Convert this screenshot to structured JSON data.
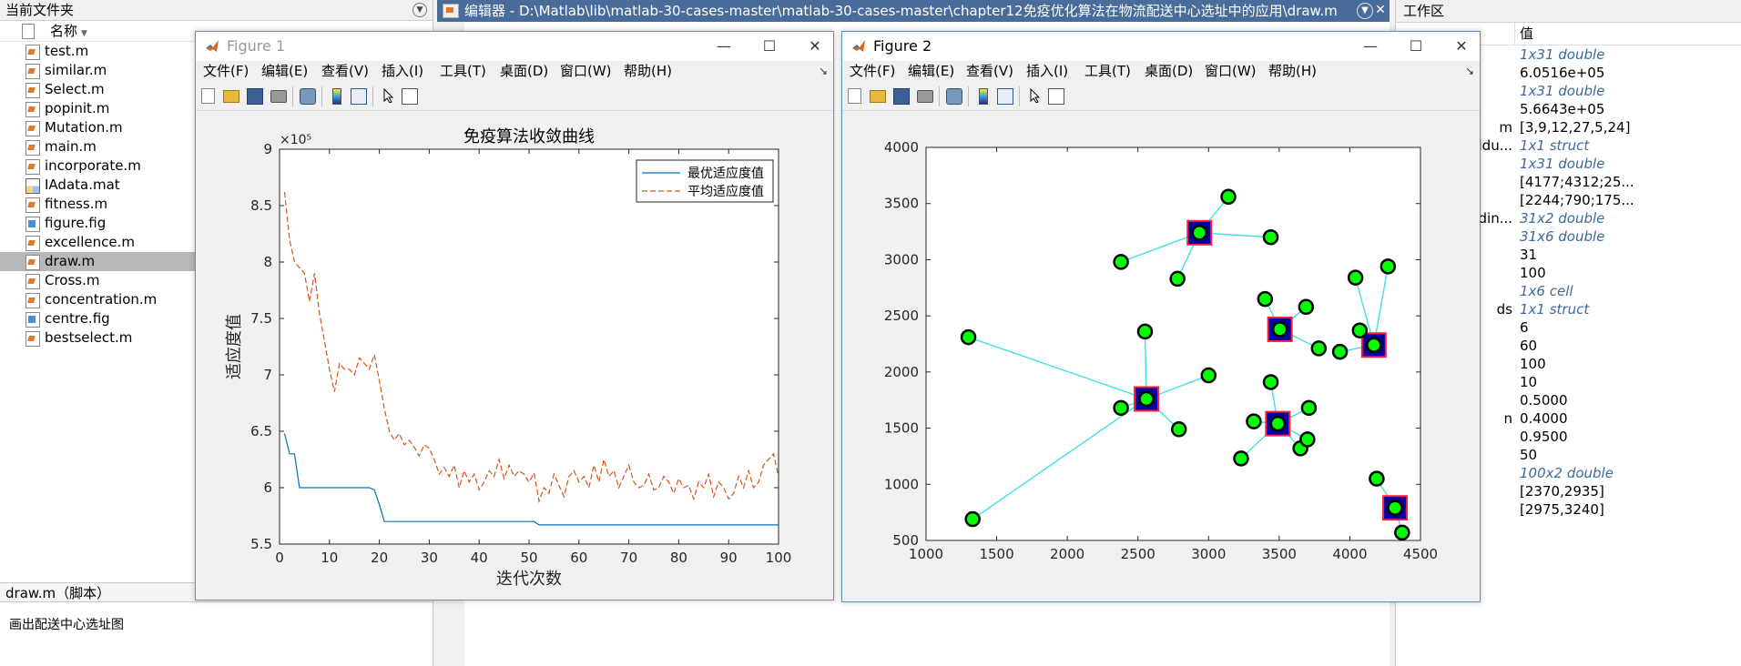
{
  "left_panel": {
    "header": "当前文件夹",
    "column_name": "名称",
    "files": [
      {
        "name": "test.m",
        "type": "m"
      },
      {
        "name": "similar.m",
        "type": "m"
      },
      {
        "name": "Select.m",
        "type": "m"
      },
      {
        "name": "popinit.m",
        "type": "m"
      },
      {
        "name": "Mutation.m",
        "type": "m"
      },
      {
        "name": "main.m",
        "type": "m"
      },
      {
        "name": "incorporate.m",
        "type": "m"
      },
      {
        "name": "IAdata.mat",
        "type": "mat"
      },
      {
        "name": "fitness.m",
        "type": "m"
      },
      {
        "name": "figure.fig",
        "type": "fig"
      },
      {
        "name": "excellence.m",
        "type": "m"
      },
      {
        "name": "draw.m",
        "type": "m",
        "selected": true
      },
      {
        "name": "Cross.m",
        "type": "m"
      },
      {
        "name": "concentration.m",
        "type": "m"
      },
      {
        "name": "centre.fig",
        "type": "fig"
      },
      {
        "name": "bestselect.m",
        "type": "m"
      }
    ],
    "detail_header": "draw.m（脚本）",
    "detail_text": "画出配送中心选址图"
  },
  "editor": {
    "title": "编辑器 - D:\\Matlab\\lib\\matlab-30-cases-master\\matlab-30-cases-master\\chapter12免疫优化算法在物流配送中心选址中的应用\\draw.m"
  },
  "workspace": {
    "header": "工作区",
    "value_col": "值",
    "rows": [
      {
        "name": "",
        "value": "1x31 double",
        "italic": true
      },
      {
        "name": "",
        "value": "6.0516e+05",
        "italic": false
      },
      {
        "name": "",
        "value": "1x31 double",
        "italic": true
      },
      {
        "name": "",
        "value": "5.6643e+05",
        "italic": false
      },
      {
        "name": "m",
        "value": "[3,9,12,27,5,24]",
        "italic": false
      },
      {
        "name": "idu...",
        "value": "1x1 struct",
        "italic": true
      },
      {
        "name": "",
        "value": "1x31 double",
        "italic": true
      },
      {
        "name": "",
        "value": "[4177;4312;25...",
        "italic": false
      },
      {
        "name": "",
        "value": "[2244;790;175...",
        "italic": false
      },
      {
        "name": "din...",
        "value": "31x2 double",
        "italic": true
      },
      {
        "name": "",
        "value": "31x6 double",
        "italic": true
      },
      {
        "name": "",
        "value": "31",
        "italic": false
      },
      {
        "name": "",
        "value": "100",
        "italic": false
      },
      {
        "name": "",
        "value": "1x6 cell",
        "italic": true
      },
      {
        "name": "ds",
        "value": "1x1 struct",
        "italic": true
      },
      {
        "name": "",
        "value": "6",
        "italic": false
      },
      {
        "name": "",
        "value": "60",
        "italic": false
      },
      {
        "name": "",
        "value": "100",
        "italic": false
      },
      {
        "name": "",
        "value": "10",
        "italic": false
      },
      {
        "name": "",
        "value": "0.5000",
        "italic": false
      },
      {
        "name": "n",
        "value": "0.4000",
        "italic": false
      },
      {
        "name": "",
        "value": "0.9500",
        "italic": false
      },
      {
        "name": "",
        "value": "50",
        "italic": false
      },
      {
        "name": "",
        "value": "100x2 double",
        "italic": true
      },
      {
        "name": "",
        "value": "[2370,2935]",
        "italic": false
      },
      {
        "name": "",
        "value": "[2975,3240]",
        "italic": false
      }
    ]
  },
  "menus": [
    "文件(F)",
    "编辑(E)",
    "查看(V)",
    "插入(I)",
    "工具(T)",
    "桌面(D)",
    "窗口(W)",
    "帮助(H)"
  ],
  "figure1": {
    "title": "Figure 1"
  },
  "figure2": {
    "title": "Figure 2"
  },
  "chart_data": [
    {
      "type": "line",
      "title": "免疫算法收敛曲线",
      "xlabel": "迭代次数",
      "ylabel": "适应度值",
      "exponent_label": "×10⁵",
      "xlim": [
        0,
        100
      ],
      "ylim": [
        5.5,
        9
      ],
      "xticks": [
        "0",
        "10",
        "20",
        "30",
        "40",
        "50",
        "60",
        "70",
        "80",
        "90",
        "100"
      ],
      "yticks": [
        "5.5",
        "6",
        "6.5",
        "7",
        "7.5",
        "8",
        "8.5",
        "9"
      ],
      "legend_position": "top-right",
      "series": [
        {
          "name": "最优适应度值",
          "color": "#0072bd",
          "style": "solid",
          "x": [
            1,
            2,
            3,
            4,
            5,
            18,
            19,
            20,
            21,
            51,
            52,
            100
          ],
          "y": [
            6.48,
            6.3,
            6.3,
            6.0,
            6.0,
            6.0,
            5.98,
            5.85,
            5.7,
            5.7,
            5.67,
            5.67
          ]
        },
        {
          "name": "平均适应度值",
          "color": "#d95319",
          "style": "dashed",
          "x": [
            1,
            2,
            3,
            4,
            5,
            6,
            7,
            8,
            9,
            10,
            11,
            12,
            13,
            14,
            15,
            16,
            17,
            18,
            19,
            20,
            21,
            22,
            23,
            24,
            25,
            26,
            27,
            28,
            29,
            30,
            31,
            32,
            33,
            34,
            35,
            36,
            37,
            38,
            39,
            40,
            41,
            42,
            43,
            44,
            45,
            46,
            47,
            48,
            49,
            50,
            51,
            52,
            53,
            54,
            55,
            56,
            57,
            58,
            59,
            60,
            61,
            62,
            63,
            64,
            65,
            66,
            67,
            68,
            69,
            70,
            71,
            72,
            73,
            74,
            75,
            76,
            77,
            78,
            79,
            80,
            81,
            82,
            83,
            84,
            85,
            86,
            87,
            88,
            89,
            90,
            91,
            92,
            93,
            94,
            95,
            96,
            97,
            98,
            99,
            100
          ],
          "y": [
            8.62,
            8.2,
            8.0,
            7.95,
            7.9,
            7.65,
            7.9,
            7.55,
            7.3,
            7.05,
            6.85,
            7.1,
            7.05,
            7.05,
            7.0,
            7.15,
            7.1,
            7.05,
            7.18,
            6.95,
            6.7,
            6.5,
            6.42,
            6.48,
            6.38,
            6.42,
            6.36,
            6.28,
            6.38,
            6.35,
            6.25,
            6.12,
            6.18,
            6.1,
            6.2,
            6.0,
            6.15,
            6.05,
            6.12,
            5.98,
            6.05,
            6.15,
            6.1,
            6.25,
            6.08,
            6.2,
            6.1,
            6.15,
            6.12,
            6.05,
            6.13,
            5.88,
            6.0,
            5.95,
            6.12,
            6.02,
            5.92,
            6.1,
            6.15,
            6.05,
            6.1,
            6.0,
            6.2,
            6.05,
            6.25,
            6.1,
            6.15,
            6.0,
            6.1,
            6.2,
            6.05,
            6.0,
            6.02,
            6.12,
            5.98,
            6.0,
            6.1,
            6.05,
            5.95,
            6.08,
            6.0,
            6.02,
            5.9,
            6.05,
            6.0,
            6.12,
            5.92,
            6.05,
            6.0,
            5.9,
            5.95,
            6.1,
            6.0,
            6.15,
            6.0,
            6.05,
            6.2,
            6.25,
            6.3,
            6.1
          ]
        }
      ]
    },
    {
      "type": "scatter",
      "xlim": [
        1000,
        4500
      ],
      "ylim": [
        500,
        4000
      ],
      "xticks": [
        "1000",
        "1500",
        "2000",
        "2500",
        "3000",
        "3500",
        "4000",
        "4500"
      ],
      "yticks": [
        "500",
        "1000",
        "1500",
        "2000",
        "2500",
        "3000",
        "3500",
        "4000"
      ],
      "centers_color": "#0000a0",
      "centers_edge": "#ff2040",
      "points_color": "#00ff00",
      "link_color": "#40e0e0",
      "centers": [
        [
          2560,
          1760
        ],
        [
          2935,
          3240
        ],
        [
          3505,
          2380
        ],
        [
          3490,
          1540
        ],
        [
          4170,
          2240
        ],
        [
          4320,
          790
        ]
      ],
      "points": [
        [
          1300,
          2310,
          0
        ],
        [
          1330,
          690,
          0
        ],
        [
          2550,
          2360,
          0
        ],
        [
          2380,
          1680,
          0
        ],
        [
          2790,
          1490,
          0
        ],
        [
          3000,
          1970,
          0
        ],
        [
          2560,
          1760,
          0
        ],
        [
          2380,
          2980,
          1
        ],
        [
          2780,
          2830,
          1
        ],
        [
          3140,
          3560,
          1
        ],
        [
          3440,
          3200,
          1
        ],
        [
          2935,
          3240,
          1
        ],
        [
          3400,
          2650,
          2
        ],
        [
          3690,
          2580,
          2
        ],
        [
          3780,
          2210,
          2
        ],
        [
          3505,
          2380,
          2
        ],
        [
          3440,
          1910,
          3
        ],
        [
          3320,
          1560,
          3
        ],
        [
          3230,
          1230,
          3
        ],
        [
          3650,
          1320,
          3
        ],
        [
          3700,
          1400,
          3
        ],
        [
          3710,
          1680,
          3
        ],
        [
          3490,
          1540,
          3
        ],
        [
          3930,
          2180,
          4
        ],
        [
          4040,
          2840,
          4
        ],
        [
          4070,
          2370,
          4
        ],
        [
          4270,
          2940,
          4
        ],
        [
          4170,
          2240,
          4
        ],
        [
          4190,
          1050,
          5
        ],
        [
          4370,
          570,
          5
        ],
        [
          4320,
          790,
          5
        ]
      ]
    }
  ]
}
